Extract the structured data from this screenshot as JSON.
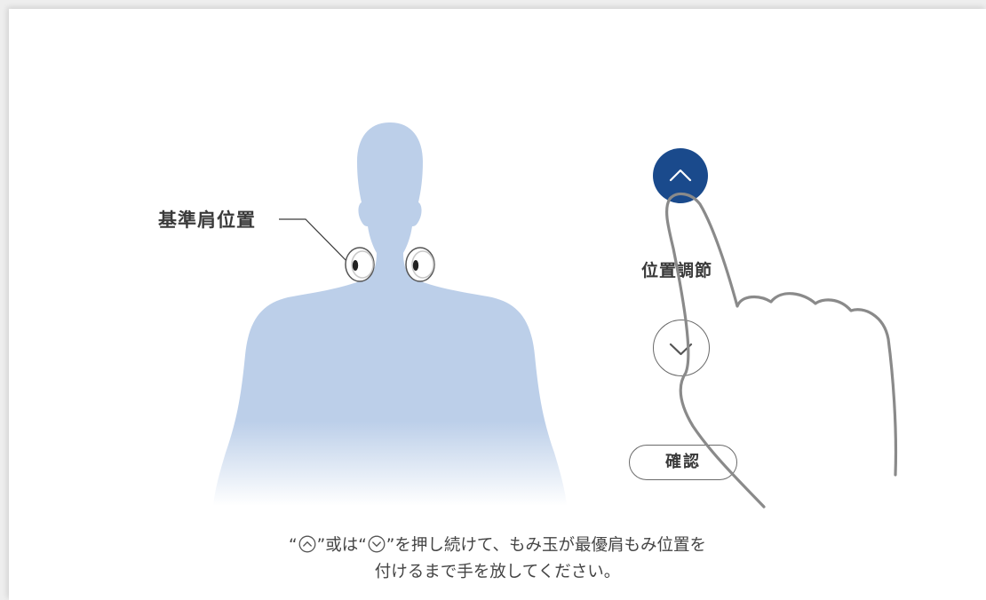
{
  "colors": {
    "body_silhouette": "#bccfe9",
    "button_primary": "#1a4a8c",
    "text": "#3a3a3a",
    "outline": "#6a6a6a",
    "hand_outline": "#8a8a8a"
  },
  "figure": {
    "reference_label": "基準肩位置"
  },
  "controls": {
    "up_icon": "chevron-up-icon",
    "adjust_label": "位置調節",
    "down_icon": "chevron-down-icon",
    "confirm_label": "確認"
  },
  "instructions": {
    "line1_open": "“",
    "line1_mid1": "”或は“",
    "line1_mid2": "”を押し続けて、もみ玉が最優肩もみ位置を",
    "line2": "付けるまで手を放してください。"
  }
}
